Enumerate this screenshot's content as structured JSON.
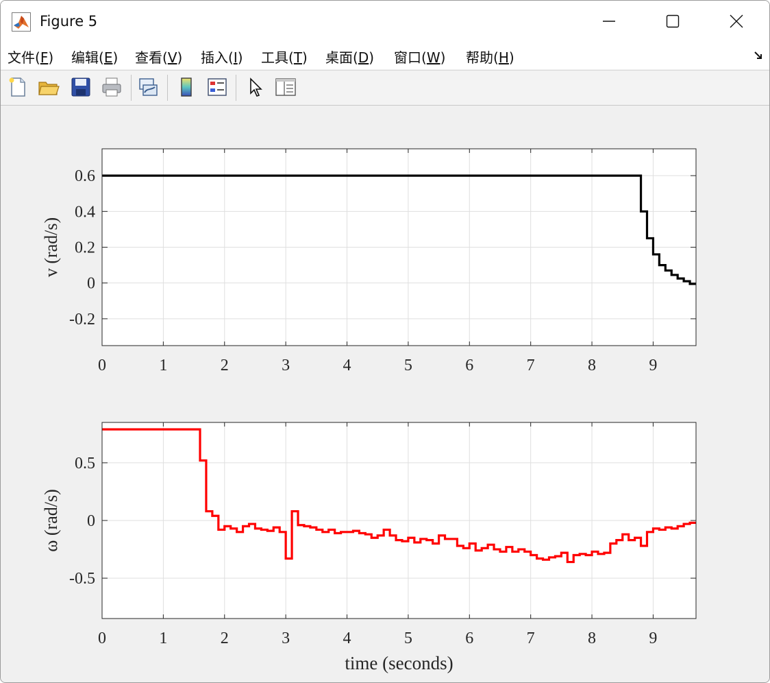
{
  "window": {
    "title": "Figure 5"
  },
  "menu": [
    {
      "label": "文件(",
      "key": "F",
      "end": ")"
    },
    {
      "label": "编辑(",
      "key": "E",
      "end": ")"
    },
    {
      "label": "查看(",
      "key": "V",
      "end": ")"
    },
    {
      "label": "插入(",
      "key": "I",
      "end": ")"
    },
    {
      "label": "工具(",
      "key": "T",
      "end": ")"
    },
    {
      "label": "桌面(",
      "key": "D",
      "end": ")"
    },
    {
      "label": "窗口(",
      "key": "W",
      "end": ")"
    },
    {
      "label": "帮助(",
      "key": "H",
      "end": ")"
    }
  ],
  "toolbar": [
    {
      "icon": "new-file-icon"
    },
    {
      "icon": "open-folder-icon"
    },
    {
      "icon": "save-icon"
    },
    {
      "icon": "print-icon"
    },
    {
      "icon": "link-plot-icon"
    },
    {
      "icon": "colorbar-icon"
    },
    {
      "icon": "legend-icon"
    },
    {
      "icon": "pointer-icon"
    },
    {
      "icon": "property-inspector-icon"
    }
  ],
  "chart_data": [
    {
      "type": "line",
      "title": "",
      "xlabel": "",
      "ylabel": "v (rad/s)",
      "xlim": [
        0,
        9.7
      ],
      "ylim": [
        -0.35,
        0.75
      ],
      "xticks": [
        "0",
        "1",
        "2",
        "3",
        "4",
        "5",
        "6",
        "7",
        "8",
        "9"
      ],
      "yticks": [
        "-0.2",
        "0",
        "0.2",
        "0.4",
        "0.6"
      ],
      "grid": true,
      "step": true,
      "color": "#000000",
      "series": [
        {
          "x": [
            0,
            8.8,
            8.9,
            9.0,
            9.1,
            9.2,
            9.3,
            9.4,
            9.5,
            9.6,
            9.7
          ],
          "y": [
            0.6,
            0.4,
            0.25,
            0.16,
            0.1,
            0.07,
            0.045,
            0.025,
            0.01,
            -0.005,
            -0.005
          ]
        }
      ]
    },
    {
      "type": "line",
      "title": "",
      "xlabel": "time (seconds)",
      "ylabel": "ω (rad/s)",
      "xlim": [
        0,
        9.7
      ],
      "ylim": [
        -0.85,
        0.85
      ],
      "xticks": [
        "0",
        "1",
        "2",
        "3",
        "4",
        "5",
        "6",
        "7",
        "8",
        "9"
      ],
      "yticks": [
        "-0.5",
        "0",
        "0.5"
      ],
      "grid": true,
      "step": true,
      "color": "#ff0000",
      "series": [
        {
          "x": [
            0,
            1.6,
            1.7,
            1.8,
            1.9,
            2.0,
            2.1,
            2.2,
            2.3,
            2.4,
            2.5,
            2.6,
            2.7,
            2.8,
            2.9,
            3.0,
            3.1,
            3.2,
            3.3,
            3.4,
            3.5,
            3.6,
            3.7,
            3.8,
            3.9,
            4.0,
            4.1,
            4.2,
            4.3,
            4.4,
            4.5,
            4.6,
            4.7,
            4.8,
            4.9,
            5.0,
            5.1,
            5.2,
            5.3,
            5.4,
            5.5,
            5.6,
            5.7,
            5.8,
            5.9,
            6.0,
            6.1,
            6.2,
            6.3,
            6.4,
            6.5,
            6.6,
            6.7,
            6.8,
            6.9,
            7.0,
            7.1,
            7.2,
            7.3,
            7.4,
            7.5,
            7.6,
            7.7,
            7.8,
            7.9,
            8.0,
            8.1,
            8.2,
            8.3,
            8.4,
            8.5,
            8.6,
            8.7,
            8.8,
            8.9,
            9.0,
            9.1,
            9.2,
            9.3,
            9.4,
            9.5,
            9.6,
            9.7
          ],
          "y": [
            0.79,
            0.52,
            0.08,
            0.04,
            -0.08,
            -0.05,
            -0.07,
            -0.1,
            -0.05,
            -0.03,
            -0.07,
            -0.08,
            -0.09,
            -0.06,
            -0.1,
            -0.33,
            0.08,
            -0.04,
            -0.05,
            -0.06,
            -0.08,
            -0.1,
            -0.08,
            -0.11,
            -0.1,
            -0.1,
            -0.09,
            -0.11,
            -0.12,
            -0.15,
            -0.13,
            -0.08,
            -0.13,
            -0.17,
            -0.18,
            -0.15,
            -0.19,
            -0.16,
            -0.17,
            -0.2,
            -0.13,
            -0.16,
            -0.16,
            -0.22,
            -0.24,
            -0.2,
            -0.26,
            -0.24,
            -0.21,
            -0.25,
            -0.27,
            -0.23,
            -0.27,
            -0.25,
            -0.27,
            -0.3,
            -0.33,
            -0.34,
            -0.32,
            -0.31,
            -0.28,
            -0.36,
            -0.3,
            -0.29,
            -0.3,
            -0.27,
            -0.29,
            -0.28,
            -0.2,
            -0.17,
            -0.12,
            -0.17,
            -0.15,
            -0.22,
            -0.1,
            -0.07,
            -0.08,
            -0.06,
            -0.07,
            -0.05,
            -0.03,
            -0.02,
            -0.02
          ]
        }
      ]
    }
  ]
}
